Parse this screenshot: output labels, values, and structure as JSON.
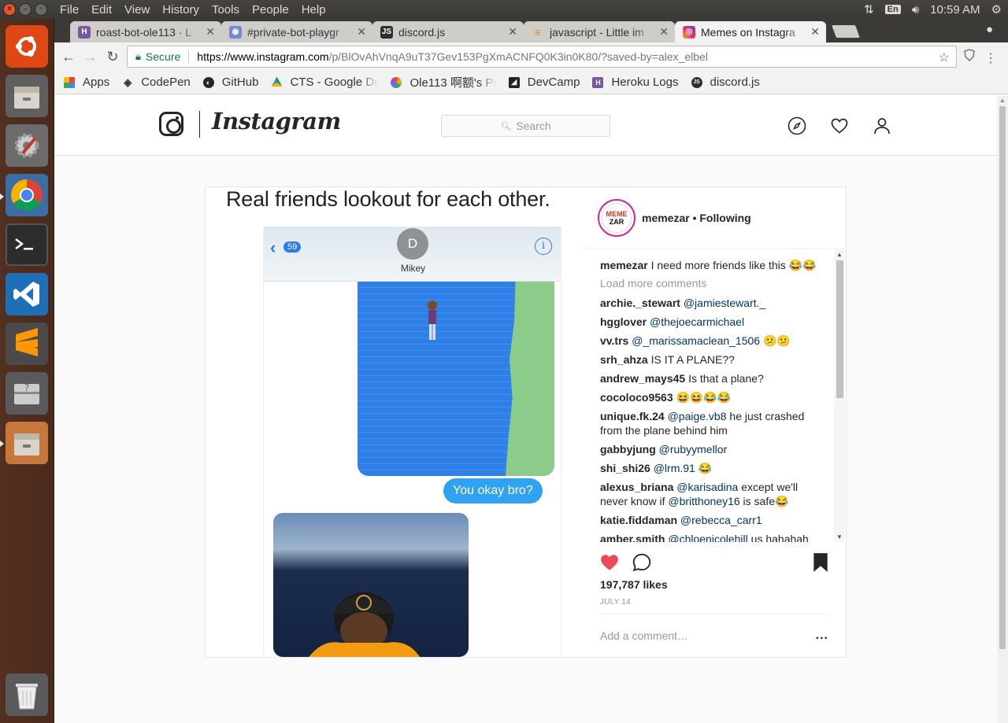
{
  "os": {
    "menu": [
      "File",
      "Edit",
      "View",
      "History",
      "Tools",
      "People",
      "Help"
    ],
    "keyboard_layout": "En",
    "clock": "10:59 AM"
  },
  "launcher": {
    "items": [
      "ubuntu-dash",
      "files",
      "system-settings",
      "chrome",
      "terminal",
      "vscode",
      "sublime-text",
      "unknown-app",
      "files-2",
      "trash"
    ]
  },
  "browser": {
    "tabs": [
      {
        "title": "roast-bot-ole113 · L",
        "icon": "heroku-icon",
        "color": "#79589f"
      },
      {
        "title": "#private-bot-playgr",
        "icon": "discord-notify-icon",
        "color": "#7289da"
      },
      {
        "title": "discord.js",
        "icon": "discordjs-icon",
        "color": "#2c2f33"
      },
      {
        "title": "javascript - Little im",
        "icon": "stackoverflow-icon",
        "color": "#f48024"
      },
      {
        "title": "Memes on Instagra",
        "icon": "instagram-icon",
        "color": "#e1306c"
      }
    ],
    "secure_label": "Secure",
    "url_host": "https://www.instagram.com",
    "url_path": "/p/BlOvAhVnqA9uT37Gev153PgXmACNFQ0K3in0K80/?saved-by=alex_elbel",
    "bookmarks": [
      {
        "label": "Apps",
        "icon": "apps-grid-icon"
      },
      {
        "label": "CodePen",
        "icon": "codepen-icon"
      },
      {
        "label": "GitHub",
        "icon": "github-icon"
      },
      {
        "label": "CTS - Google Dri",
        "icon": "google-drive-icon"
      },
      {
        "label": "Ole113 啊额's Pi",
        "icon": "picasa-icon"
      },
      {
        "label": "DevCamp",
        "icon": "devcamp-icon"
      },
      {
        "label": "Heroku Logs",
        "icon": "heroku-icon"
      },
      {
        "label": "discord.js",
        "icon": "discordjs-icon"
      }
    ]
  },
  "instagram": {
    "wordmark": "Instagram",
    "search_placeholder": "Search",
    "post": {
      "meme_caption": "Real friends lookout for each other.",
      "chat": {
        "back_count": "59",
        "contact_initial": "D",
        "contact_name": "Mikey",
        "message": "You okay bro?"
      },
      "owner": "memezar",
      "follow_state": "Following",
      "owner_line": "memezar • Following",
      "owner_avatar_text": [
        "MEME",
        "ZAR"
      ],
      "caption_user": "memezar",
      "caption_text": "I need more friends like this 😂😂",
      "load_more": "Load more comments",
      "comments": [
        {
          "user": "archie._stewart",
          "mention": "@jamiestewart._",
          "text": ""
        },
        {
          "user": "hgglover",
          "mention": "@thejoecarmichael",
          "text": ""
        },
        {
          "user": "vv.trs",
          "mention": "@_marissamaclean_1506",
          "text": "😕😕"
        },
        {
          "user": "srh_ahza",
          "mention": "",
          "text": "IS IT A PLANE??"
        },
        {
          "user": "andrew_mays45",
          "mention": "",
          "text": "Is that a plane?"
        },
        {
          "user": "cocoloco9563",
          "mention": "",
          "text": "😆😆😂😂"
        },
        {
          "user": "unique.fk.24",
          "mention": "@paige.vb8",
          "text": "he just crashed from the plane behind him"
        },
        {
          "user": "gabbyjung",
          "mention": "@rubyymellor",
          "text": ""
        },
        {
          "user": "shi_shi26",
          "mention": "@lrm.91",
          "text": "😂"
        },
        {
          "user": "alexus_briana",
          "mention": "@karisadina",
          "text": "except we'll never know if",
          "mention2": "@britthoney16",
          "text2": "is safe😂"
        },
        {
          "user": "katie.fiddaman",
          "mention": "@rebecca_carr1",
          "text": ""
        },
        {
          "user": "amber.smith",
          "mention": "@chloenicolehill",
          "text": "us hahahah"
        }
      ],
      "liked": true,
      "likes": "197,787 likes",
      "date": "JULY 14",
      "add_comment_placeholder": "Add a comment…",
      "more_label": "..."
    }
  },
  "colors": {
    "like_red": "#ed4956",
    "mention_blue": "#003569",
    "secure_green": "#0b8043"
  }
}
